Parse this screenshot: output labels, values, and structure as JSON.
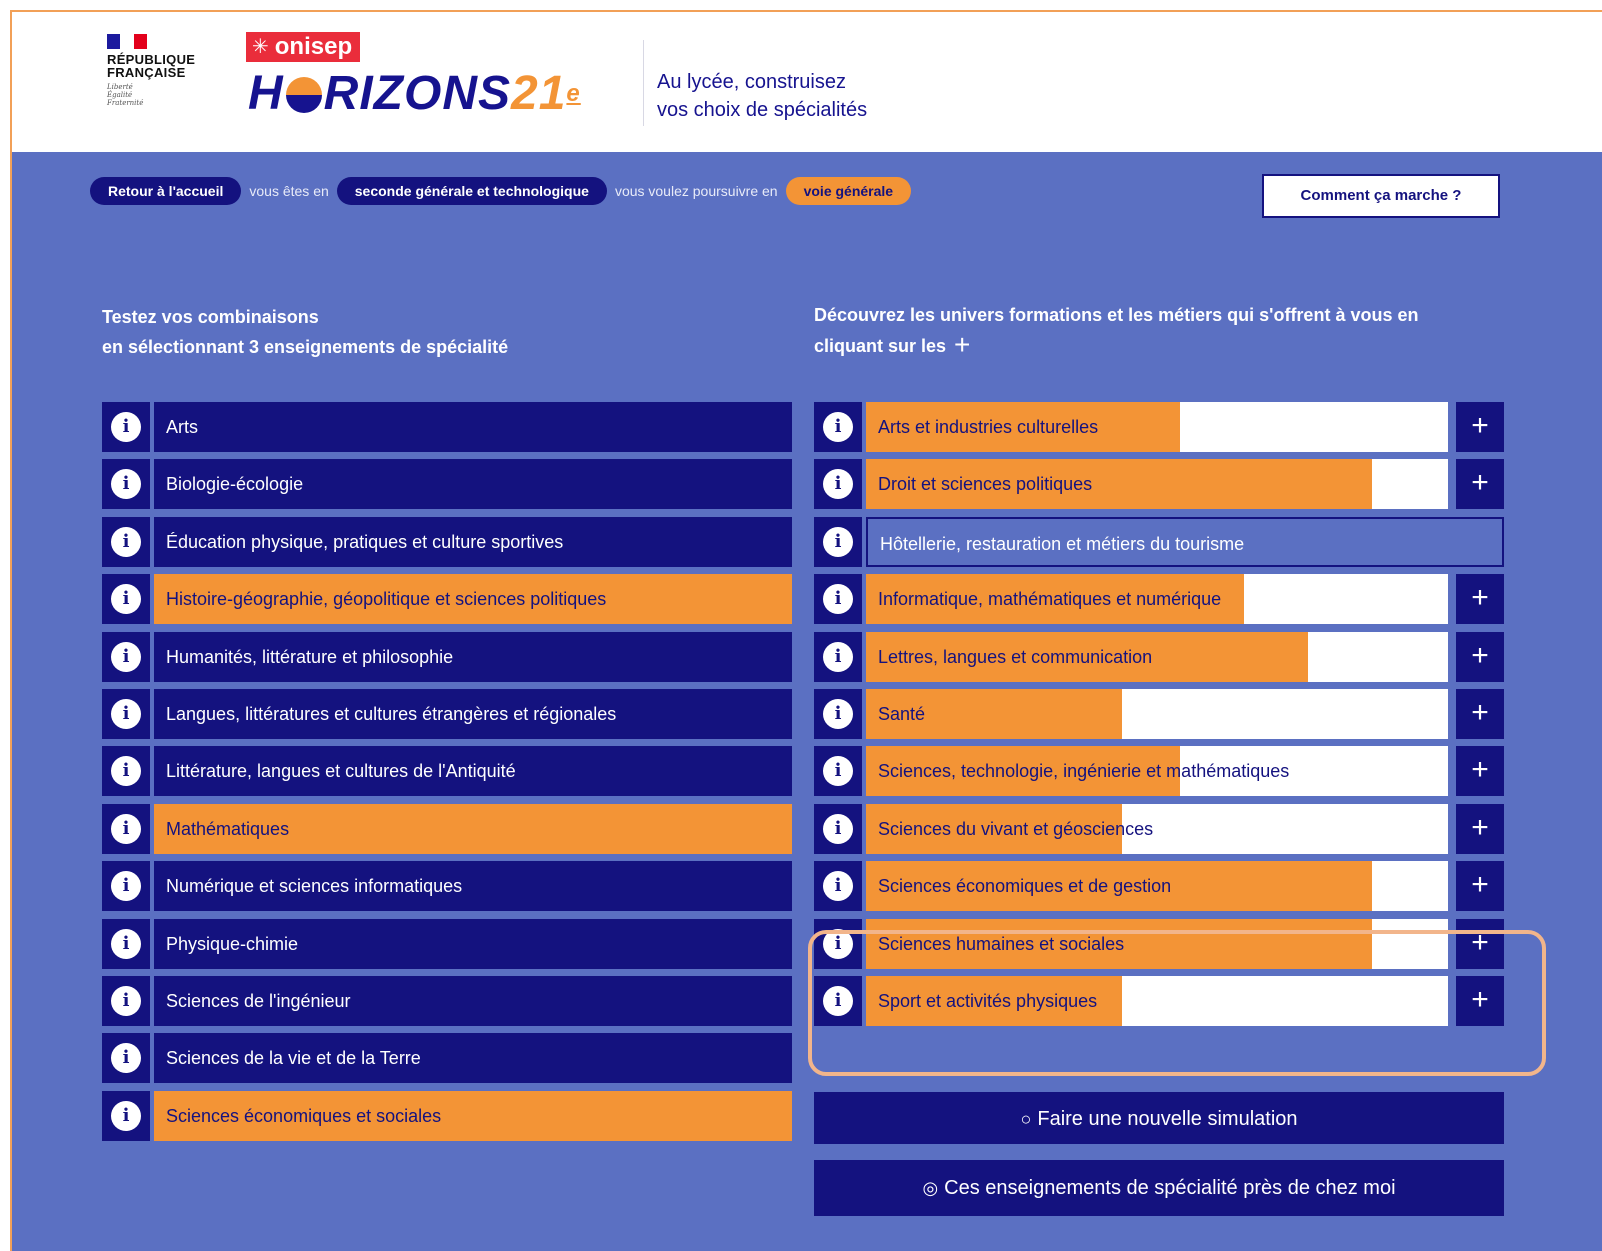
{
  "header": {
    "rf_name_line1": "RÉPUBLIQUE",
    "rf_name_line2": "FRANÇAISE",
    "rf_motto": [
      "Liberté",
      "Égalité",
      "Fraternité"
    ],
    "onisep_label": "onisep",
    "horizons_h": "H",
    "horizons_rest": "RIZONS",
    "horizons_21": "21",
    "horizons_sup": "e",
    "tagline_line1": "Au lycée, construisez",
    "tagline_line2": "vos choix de spécialités"
  },
  "crumbs": {
    "home": "Retour à l'accueil",
    "you_are_in": "vous êtes en",
    "level": "seconde générale et technologique",
    "you_want": "vous voulez poursuivre en",
    "path": "voie générale"
  },
  "how_button": "Comment ça marche ?",
  "left_title": {
    "line1": "Testez vos combinaisons",
    "line2": "en sélectionnant 3 enseignements de spécialité"
  },
  "right_title": {
    "line1": "Découvrez les univers formations et les métiers qui s'offrent à vous en",
    "line2": "cliquant sur les",
    "plus": "+"
  },
  "info_glyph": "i",
  "plus_glyph": "+",
  "specialties": [
    {
      "label": "Arts",
      "selected": false
    },
    {
      "label": "Biologie-écologie",
      "selected": false
    },
    {
      "label": "Éducation physique, pratiques et culture sportives",
      "selected": false
    },
    {
      "label": "Histoire-géographie, géopolitique et sciences politiques",
      "selected": true
    },
    {
      "label": "Humanités, littérature et philosophie",
      "selected": false
    },
    {
      "label": "Langues, littératures et cultures étrangères et régionales",
      "selected": false
    },
    {
      "label": "Littérature, langues et cultures de l'Antiquité",
      "selected": false
    },
    {
      "label": "Mathématiques",
      "selected": true
    },
    {
      "label": "Numérique et sciences informatiques",
      "selected": false
    },
    {
      "label": "Physique-chimie",
      "selected": false
    },
    {
      "label": "Sciences de l'ingénieur",
      "selected": false
    },
    {
      "label": "Sciences de la vie et de la Terre",
      "selected": false
    },
    {
      "label": "Sciences économiques et sociales",
      "selected": true
    }
  ],
  "universes": [
    {
      "label": "Arts et industries culturelles",
      "fill": 0.54,
      "disabled": false
    },
    {
      "label": "Droit et sciences politiques",
      "fill": 0.87,
      "disabled": false
    },
    {
      "label": "Hôtellerie, restauration et métiers du tourisme",
      "fill": 0,
      "disabled": true
    },
    {
      "label": "Informatique, mathématiques et numérique",
      "fill": 0.65,
      "disabled": false
    },
    {
      "label": "Lettres, langues et communication",
      "fill": 0.76,
      "disabled": false
    },
    {
      "label": "Santé",
      "fill": 0.44,
      "disabled": false
    },
    {
      "label": "Sciences, technologie, ingénierie et mathématiques",
      "fill": 0.54,
      "disabled": false
    },
    {
      "label": "Sciences du vivant et géosciences",
      "fill": 0.44,
      "disabled": false
    },
    {
      "label": "Sciences économiques et de gestion",
      "fill": 0.87,
      "disabled": false
    },
    {
      "label": "Sciences humaines et sociales",
      "fill": 0.87,
      "disabled": false
    },
    {
      "label": "Sport et activités physiques",
      "fill": 0.44,
      "disabled": false
    }
  ],
  "actions": {
    "new_simulation": "Faire une nouvelle simulation",
    "near_me": "Ces enseignements de spécialité près de chez moi",
    "refresh_icon": "○",
    "location_icon": "◎"
  },
  "colors": {
    "navy": "#14127f",
    "orange": "#f39436",
    "background_blue": "#5b70c2"
  }
}
